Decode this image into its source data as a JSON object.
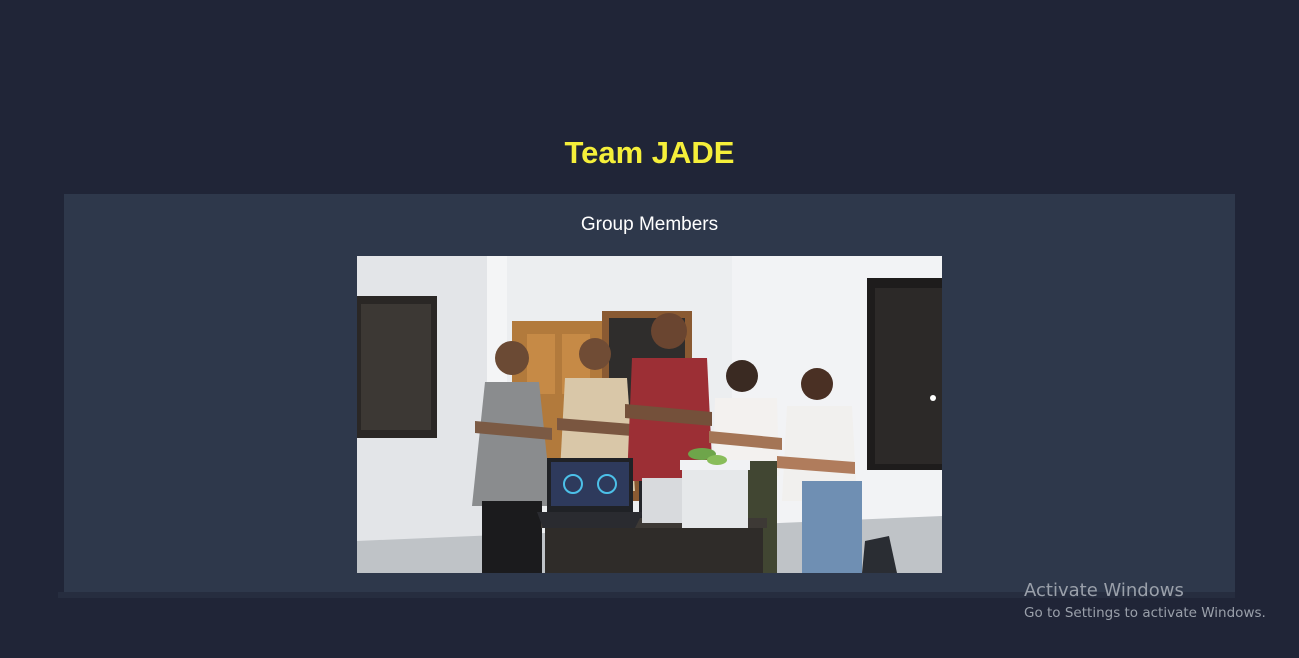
{
  "page": {
    "title": "Team JADE"
  },
  "section": {
    "heading": "Group Members",
    "photo_alt": "Group Members"
  },
  "watermark": {
    "title": "Activate Windows",
    "subtitle": "Go to Settings to activate Windows."
  },
  "colors": {
    "background": "#202537",
    "panel": "#2e384b",
    "title": "#f5ef3a",
    "heading": "#ffffff",
    "watermark": "#9aa0aa"
  }
}
